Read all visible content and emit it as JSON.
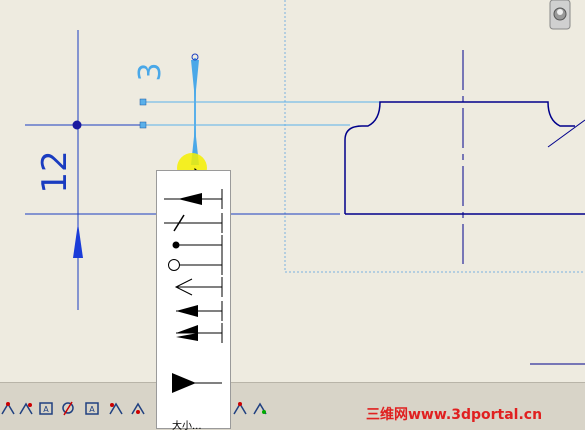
{
  "drawing": {
    "dimension_vertical": "12",
    "dimension_top": "3"
  },
  "arrow_menu": {
    "items": [
      {
        "name": "filled-arrow"
      },
      {
        "name": "slash-tick"
      },
      {
        "name": "filled-dot"
      },
      {
        "name": "open-circle"
      },
      {
        "name": "open-arrow"
      },
      {
        "name": "filled-arrow-small"
      },
      {
        "name": "half-arrow"
      },
      {
        "name": "filled-triangle-large"
      }
    ],
    "size_label": "大小..."
  },
  "toolbar": {
    "buttons": [
      "dim-tool",
      "dim-tool",
      "dim-tool",
      "dim-tool",
      "dim-tool",
      "dim-tool",
      "dim-tool",
      "dim-tool"
    ]
  },
  "watermark": "三维网www.3dportal.cn",
  "colors": {
    "background": "#eeebe0",
    "geometry": "#00008b",
    "dimension": "#1a56d6",
    "highlight": "#f5f000",
    "watermark": "#e02020"
  }
}
